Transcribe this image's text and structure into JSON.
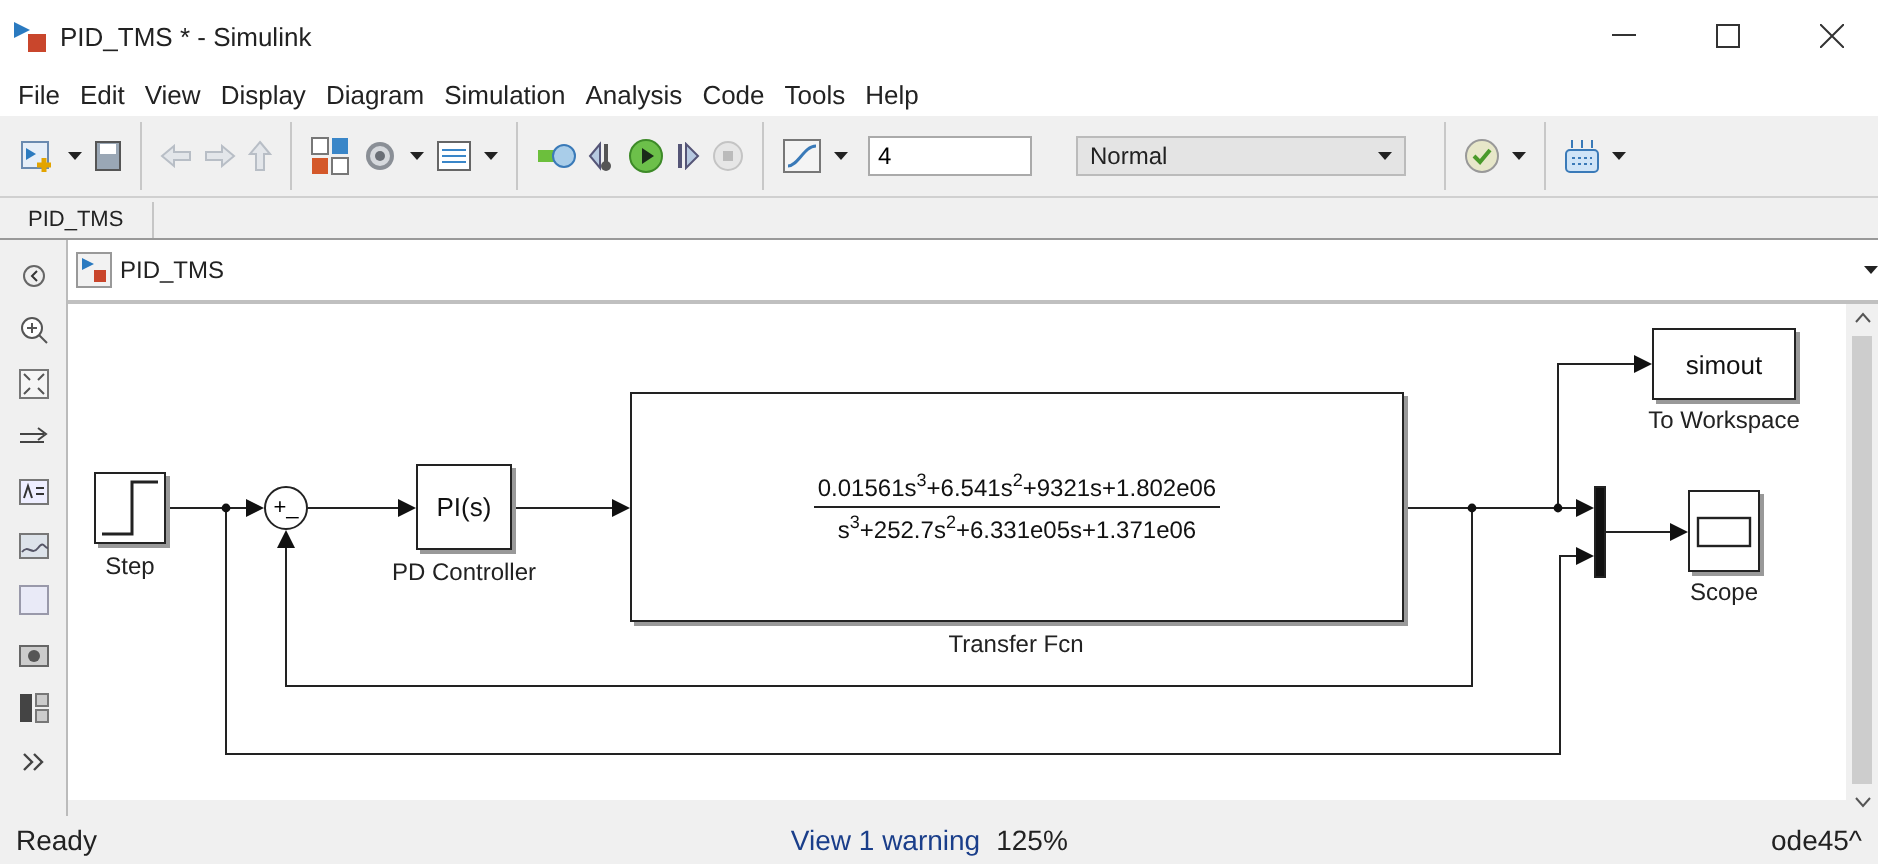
{
  "window": {
    "title": "PID_TMS * - Simulink"
  },
  "menu": [
    "File",
    "Edit",
    "View",
    "Display",
    "Diagram",
    "Simulation",
    "Analysis",
    "Code",
    "Tools",
    "Help"
  ],
  "toolbar": {
    "stop_time": "4",
    "sim_mode": "Normal"
  },
  "tabs": [
    {
      "label": "PID_TMS",
      "selected": true
    }
  ],
  "breadcrumb": {
    "path": "PID_TMS"
  },
  "diagram": {
    "blocks": [
      {
        "kind": "step",
        "label": "Step"
      },
      {
        "kind": "sum",
        "signs": [
          "+",
          "_"
        ]
      },
      {
        "kind": "controller",
        "text": "PI(s)",
        "label": "PD Controller"
      },
      {
        "kind": "transfer_fcn",
        "numerator": "0.01561s$^{3}$+6.541s$^{2}$+9321s+1.802e06",
        "denominator": "s$^{3}$+252.7s$^{2}$+6.331e05s+1.371e06",
        "label": "Transfer Fcn"
      },
      {
        "kind": "to_workspace",
        "text": "simout",
        "label": "To Workspace"
      },
      {
        "kind": "mux"
      },
      {
        "kind": "scope",
        "label": "Scope"
      }
    ]
  },
  "status_bar": {
    "state": "Ready",
    "warnings": "View 1 warning",
    "zoom": "125%",
    "solver": "ode45^"
  }
}
